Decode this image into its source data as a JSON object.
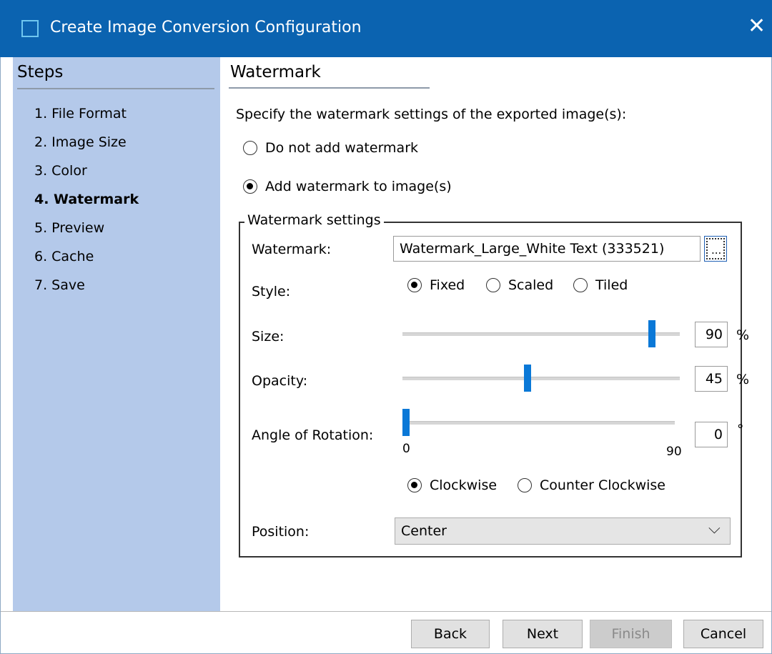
{
  "window": {
    "title": "Create Image Conversion Configuration"
  },
  "steps": {
    "title": "Steps",
    "items": [
      {
        "label": "1. File Format",
        "active": false
      },
      {
        "label": "2. Image Size",
        "active": false
      },
      {
        "label": "3. Color",
        "active": false
      },
      {
        "label": "4. Watermark",
        "active": true
      },
      {
        "label": "5. Preview",
        "active": false
      },
      {
        "label": "6. Cache",
        "active": false
      },
      {
        "label": "7. Save",
        "active": false
      }
    ]
  },
  "page": {
    "title": "Watermark",
    "instruction": "Specify the watermark settings of the exported image(s):",
    "mode_options": [
      {
        "label": "Do not add watermark",
        "selected": false
      },
      {
        "label": "Add watermark to image(s)",
        "selected": true
      }
    ]
  },
  "settings": {
    "group_title": "Watermark settings",
    "watermark": {
      "label": "Watermark:",
      "value": "Watermark_Large_White Text (333521)",
      "browse_label": "..."
    },
    "style": {
      "label": "Style:",
      "options": [
        {
          "label": "Fixed",
          "selected": true
        },
        {
          "label": "Scaled",
          "selected": false
        },
        {
          "label": "Tiled",
          "selected": false
        }
      ]
    },
    "size": {
      "label": "Size:",
      "value": "90",
      "unit": "%",
      "fraction": 0.9
    },
    "opacity": {
      "label": "Opacity:",
      "value": "45",
      "unit": "%",
      "fraction": 0.45
    },
    "rotation": {
      "label": "Angle of Rotation:",
      "value": "0",
      "unit": "°",
      "min_label": "0",
      "max_label": "90",
      "fraction": 0
    },
    "direction": [
      {
        "label": "Clockwise",
        "selected": true
      },
      {
        "label": "Counter Clockwise",
        "selected": false
      }
    ],
    "position": {
      "label": "Position:",
      "value": "Center"
    }
  },
  "buttons": {
    "back": "Back",
    "next": "Next",
    "finish": "Finish",
    "cancel": "Cancel"
  },
  "colors": {
    "titlebar": "#0b63b0",
    "steps_panel": "#b4c9ea",
    "slider_thumb": "#0a78d7"
  }
}
